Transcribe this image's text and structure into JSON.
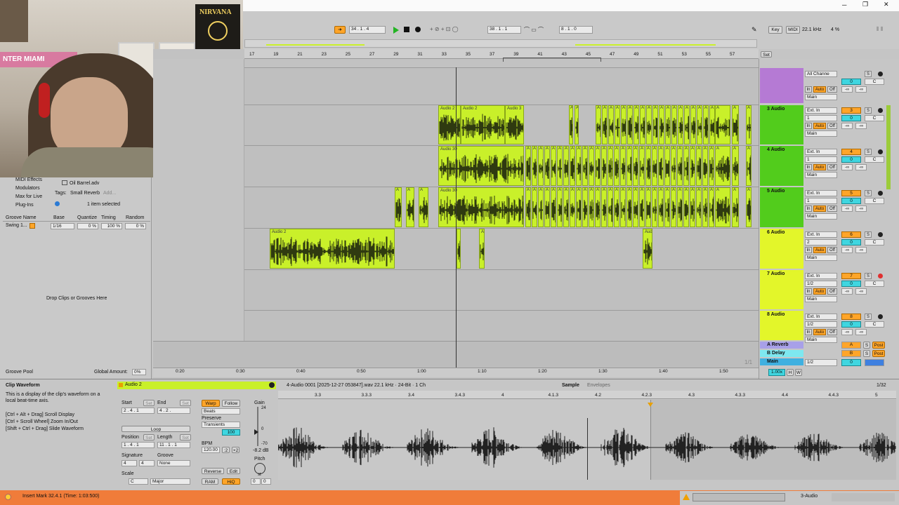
{
  "webcam": {
    "poster_text": "NIRVANA",
    "banner_text": "NTER MIAMI"
  },
  "window": {
    "minimize": "─",
    "restore": "❐",
    "close": "✕"
  },
  "transport": {
    "bar_pos": "34 .  1 .  4",
    "loop_pos": "38 .  1 .  1",
    "loop_len": "8 .  1 .  0"
  },
  "top_right": {
    "key": "Key",
    "midi": "MIDI",
    "rate": "22.1 kHz",
    "cpu": "4 %"
  },
  "ruler": {
    "bars": [
      "17",
      "19",
      "21",
      "23",
      "25",
      "27",
      "29",
      "31",
      "33",
      "35",
      "37",
      "39",
      "41",
      "43",
      "45",
      "47",
      "49",
      "51",
      "53",
      "55",
      "57"
    ],
    "set": "Set"
  },
  "tracks": [
    {
      "name": "",
      "input": "All Channe",
      "ch": "",
      "num": "",
      "vol": "0",
      "pan": "C",
      "route": "Main",
      "send": "-∞"
    },
    {
      "name": "3 Audio",
      "input": "Ext. In",
      "ch": "1",
      "num": "3",
      "vol": "0",
      "pan": "C",
      "route": "Main",
      "send": "-∞"
    },
    {
      "name": "4 Audio",
      "input": "Ext. In",
      "ch": "1",
      "num": "4",
      "vol": "0",
      "pan": "C",
      "route": "Main",
      "send": "-∞"
    },
    {
      "name": "5 Audio",
      "input": "Ext. In",
      "ch": "1",
      "num": "5",
      "vol": "0",
      "pan": "C",
      "route": "Main",
      "send": "-∞"
    },
    {
      "name": "6 Audio",
      "input": "Ext. In",
      "ch": "2",
      "num": "6",
      "vol": "0",
      "pan": "C",
      "route": "Main",
      "send": "-∞"
    },
    {
      "name": "7 Audio",
      "input": "Ext. In",
      "ch": "1/2",
      "num": "7",
      "vol": "0",
      "pan": "C",
      "route": "Main",
      "send": "-∞"
    },
    {
      "name": "8 Audio",
      "input": "Ext. In",
      "ch": "1/2",
      "num": "8",
      "vol": "0",
      "pan": "C",
      "route": "Main",
      "send": "-∞"
    }
  ],
  "monitor": {
    "in": "In",
    "auto": "Auto",
    "off": "Off",
    "solo": "S"
  },
  "returns": [
    {
      "name": "A Reverb",
      "letter": "A",
      "post": "Post"
    },
    {
      "name": "B Delay",
      "letter": "B",
      "post": "Post"
    }
  ],
  "main_track": {
    "name": "Main",
    "route": "1/2",
    "vol": "0",
    "zoom": "1.00x",
    "h": "H",
    "w": "W",
    "fraction": "1/1"
  },
  "clips": {
    "a2a": "Audio 2",
    "a2b": "Audio 2",
    "a3": "Audio 3",
    "a30": "Audio 30",
    "a30b": "Audio 30",
    "a2c": "Audio 2",
    "au": "Au",
    "aud": "Aud",
    "audio": "Audio",
    "a": "A"
  },
  "time_ruler": [
    "0:20",
    "0:30",
    "0:40",
    "0:50",
    "1:00",
    "1:10",
    "1:20",
    "1:30",
    "1:40",
    "1:50"
  ],
  "browser": {
    "items": [
      "MIDI Effects",
      "Modulators",
      "Max for Live",
      "Plug-Ins"
    ],
    "file": "Oil Barrel.adv",
    "tags_label": "Tags:",
    "tag": "Small Reverb",
    "add": "Add...",
    "selected": "1 item selected"
  },
  "groove": {
    "headers": [
      "Groove Name",
      "Base",
      "Quantize",
      "Timing",
      "Random"
    ],
    "row": {
      "name": "Swing 1...",
      "base": "1/16",
      "quantize": "0 %",
      "timing": "100 %",
      "random": "0 %"
    },
    "drop": "Drop Clips or Grooves Here",
    "pool": "Groove Pool",
    "amount_label": "Global Amount:",
    "amount": "0%"
  },
  "info": {
    "title": "Clip Waveform",
    "body": "This is a display of the clip's waveform on a local beat-time axis.",
    "h1": "[Ctrl + Alt + Drag] Scroll Display",
    "h2": "[Ctrl + Scroll Wheel] Zoom In/Out",
    "h3": "[Shift + Ctrl + Drag] Slide Waveform"
  },
  "clip": {
    "name": "Audio 2",
    "start_label": "Start",
    "end_label": "End",
    "set": "Set",
    "start": "2 .  4 .  1",
    "end": "4 .  2 .",
    "loop": "Loop",
    "position_label": "Position",
    "length_label": "Length",
    "position": "1 .  4 .  1",
    "length": "11 .  1 .  1",
    "signature_label": "Signature",
    "groove_label": "Groove",
    "sig_num": "4",
    "sig_den": "4",
    "groove_val": "None",
    "scale_label": "Scale",
    "scale_root": "C",
    "scale_mode": "Major",
    "warp": "Warp",
    "follow": "Follow",
    "mode": "Beats",
    "preserve_label": "Preserve",
    "preserve": "Transients",
    "env_val": "100",
    "bpm_label": "BPM",
    "bpm": "120.00",
    "half": ":2",
    "double": "×2",
    "reverse": "Reverse",
    "edit": "Edit",
    "ram": "RAM",
    "hiq": "HiQ",
    "gain_label": "Gain",
    "gain_top": "24",
    "gain_zero": "0",
    "gain_bot": "-70",
    "gain_val": "-8.2 dB",
    "pitch_label": "Pitch",
    "pitch_unit": "st",
    "pitch_semi": "0",
    "pitch_cent": "0"
  },
  "sample": {
    "file": "4-Audio 0001 [2025-12-27 053847].wav  22.1 kHz · 24-Bit · 1 Ch",
    "tab_sample": "Sample",
    "tab_env": "Envelopes",
    "zoom": "1/32",
    "ruler": [
      "3.3",
      "3.3.3",
      "3.4",
      "3.4.3",
      "4",
      "4.1.3",
      "4.2",
      "4.2.3",
      "4.3",
      "4.3.3",
      "4.4",
      "4.4.3",
      "5"
    ]
  },
  "status": {
    "text": "Insert Mark 32.4.1 (Time: 1:03:500)",
    "track": "3-Audio"
  },
  "colors": {
    "clip": "#c9f02a",
    "track_green": "#52cc1c",
    "track_yellow": "#e3f62a",
    "track_purple": "#b57ad4",
    "status": "#f07c3a",
    "accent_orange": "#ffa529"
  }
}
